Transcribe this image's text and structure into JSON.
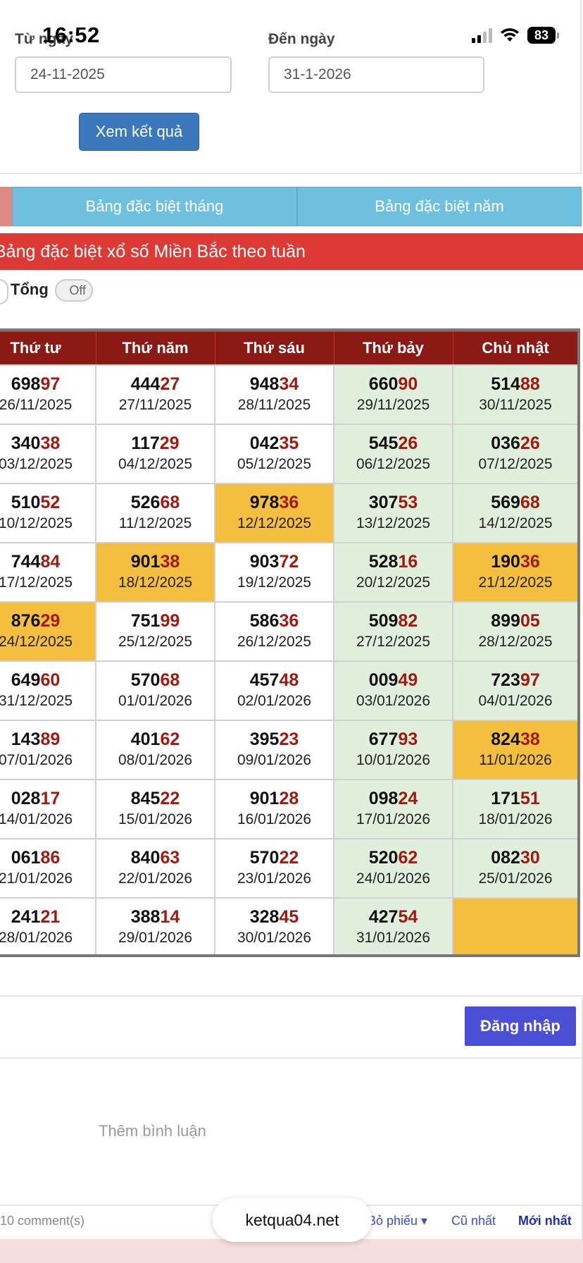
{
  "status_bar": {
    "time": "16:52",
    "battery": "83"
  },
  "filter": {
    "from_label": "Từ ngày",
    "from_value": "24-11-2025",
    "to_label": "Đến ngày",
    "to_value": "31-1-2026",
    "submit_label": "Xem kết quả"
  },
  "tabs": [
    {
      "label": "Bảng đặc biệt tháng"
    },
    {
      "label": "Bảng đặc biệt năm"
    }
  ],
  "section_title": "Bảng đặc biệt xổ số Miền Bắc theo tuần",
  "sum_toggle": {
    "label": "Tổng",
    "state": "Off"
  },
  "table": {
    "headers": [
      "Thứ tư",
      "Thứ năm",
      "Thứ sáu",
      "Thứ bảy",
      "Chủ nhật"
    ],
    "rows": [
      [
        {
          "head": "698",
          "tail": "97",
          "date": "26/11/2025"
        },
        {
          "head": "444",
          "tail": "27",
          "date": "27/11/2025"
        },
        {
          "head": "948",
          "tail": "34",
          "date": "28/11/2025"
        },
        {
          "head": "660",
          "tail": "90",
          "date": "29/11/2025"
        },
        {
          "head": "514",
          "tail": "88",
          "date": "30/11/2025"
        }
      ],
      [
        {
          "head": "340",
          "tail": "38",
          "date": "03/12/2025"
        },
        {
          "head": "117",
          "tail": "29",
          "date": "04/12/2025"
        },
        {
          "head": "042",
          "tail": "35",
          "date": "05/12/2025"
        },
        {
          "head": "545",
          "tail": "26",
          "date": "06/12/2025"
        },
        {
          "head": "036",
          "tail": "26",
          "date": "07/12/2025"
        }
      ],
      [
        {
          "head": "510",
          "tail": "52",
          "date": "10/12/2025"
        },
        {
          "head": "526",
          "tail": "68",
          "date": "11/12/2025"
        },
        {
          "head": "978",
          "tail": "36",
          "date": "12/12/2025",
          "highlight": true
        },
        {
          "head": "307",
          "tail": "53",
          "date": "13/12/2025"
        },
        {
          "head": "569",
          "tail": "68",
          "date": "14/12/2025"
        }
      ],
      [
        {
          "head": "744",
          "tail": "84",
          "date": "17/12/2025"
        },
        {
          "head": "901",
          "tail": "38",
          "date": "18/12/2025",
          "highlight": true
        },
        {
          "head": "903",
          "tail": "72",
          "date": "19/12/2025"
        },
        {
          "head": "528",
          "tail": "16",
          "date": "20/12/2025"
        },
        {
          "head": "190",
          "tail": "36",
          "date": "21/12/2025",
          "highlight": true
        }
      ],
      [
        {
          "head": "876",
          "tail": "29",
          "date": "24/12/2025",
          "highlight": true
        },
        {
          "head": "751",
          "tail": "99",
          "date": "25/12/2025"
        },
        {
          "head": "586",
          "tail": "36",
          "date": "26/12/2025"
        },
        {
          "head": "509",
          "tail": "82",
          "date": "27/12/2025"
        },
        {
          "head": "899",
          "tail": "05",
          "date": "28/12/2025"
        }
      ],
      [
        {
          "head": "649",
          "tail": "60",
          "date": "31/12/2025"
        },
        {
          "head": "570",
          "tail": "68",
          "date": "01/01/2026"
        },
        {
          "head": "457",
          "tail": "48",
          "date": "02/01/2026"
        },
        {
          "head": "009",
          "tail": "49",
          "date": "03/01/2026"
        },
        {
          "head": "723",
          "tail": "97",
          "date": "04/01/2026"
        }
      ],
      [
        {
          "head": "143",
          "tail": "89",
          "date": "07/01/2026"
        },
        {
          "head": "401",
          "tail": "62",
          "date": "08/01/2026"
        },
        {
          "head": "395",
          "tail": "23",
          "date": "09/01/2026"
        },
        {
          "head": "677",
          "tail": "93",
          "date": "10/01/2026"
        },
        {
          "head": "824",
          "tail": "38",
          "date": "11/01/2026",
          "highlight": true
        }
      ],
      [
        {
          "head": "028",
          "tail": "17",
          "date": "14/01/2026"
        },
        {
          "head": "845",
          "tail": "22",
          "date": "15/01/2026"
        },
        {
          "head": "901",
          "tail": "28",
          "date": "16/01/2026"
        },
        {
          "head": "098",
          "tail": "24",
          "date": "17/01/2026"
        },
        {
          "head": "171",
          "tail": "51",
          "date": "18/01/2026"
        }
      ],
      [
        {
          "head": "061",
          "tail": "86",
          "date": "21/01/2026"
        },
        {
          "head": "840",
          "tail": "63",
          "date": "22/01/2026"
        },
        {
          "head": "570",
          "tail": "22",
          "date": "23/01/2026"
        },
        {
          "head": "520",
          "tail": "62",
          "date": "24/01/2026"
        },
        {
          "head": "082",
          "tail": "30",
          "date": "25/01/2026"
        }
      ],
      [
        {
          "head": "241",
          "tail": "21",
          "date": "28/01/2026"
        },
        {
          "head": "388",
          "tail": "14",
          "date": "29/01/2026"
        },
        {
          "head": "328",
          "tail": "45",
          "date": "30/01/2026"
        },
        {
          "head": "427",
          "tail": "54",
          "date": "31/01/2026"
        },
        {
          "head": "",
          "tail": "",
          "date": "",
          "highlight": true
        }
      ]
    ]
  },
  "comments": {
    "login_label": "Đăng nhập",
    "placeholder": "Thêm bình luận",
    "count_text": "10 comment(s)",
    "sort_vote": "Bỏ phiếu ▾",
    "sort_oldest": "Cũ nhất",
    "sort_newest": "Mới nhất"
  },
  "site_pill": "ketqua04.net",
  "colors": {
    "header_red": "#dd3a35",
    "table_head": "#8b1a14",
    "highlight": "#f4bf3f",
    "weekend": "#e0efdc",
    "tab_blue": "#6fbfdf"
  }
}
